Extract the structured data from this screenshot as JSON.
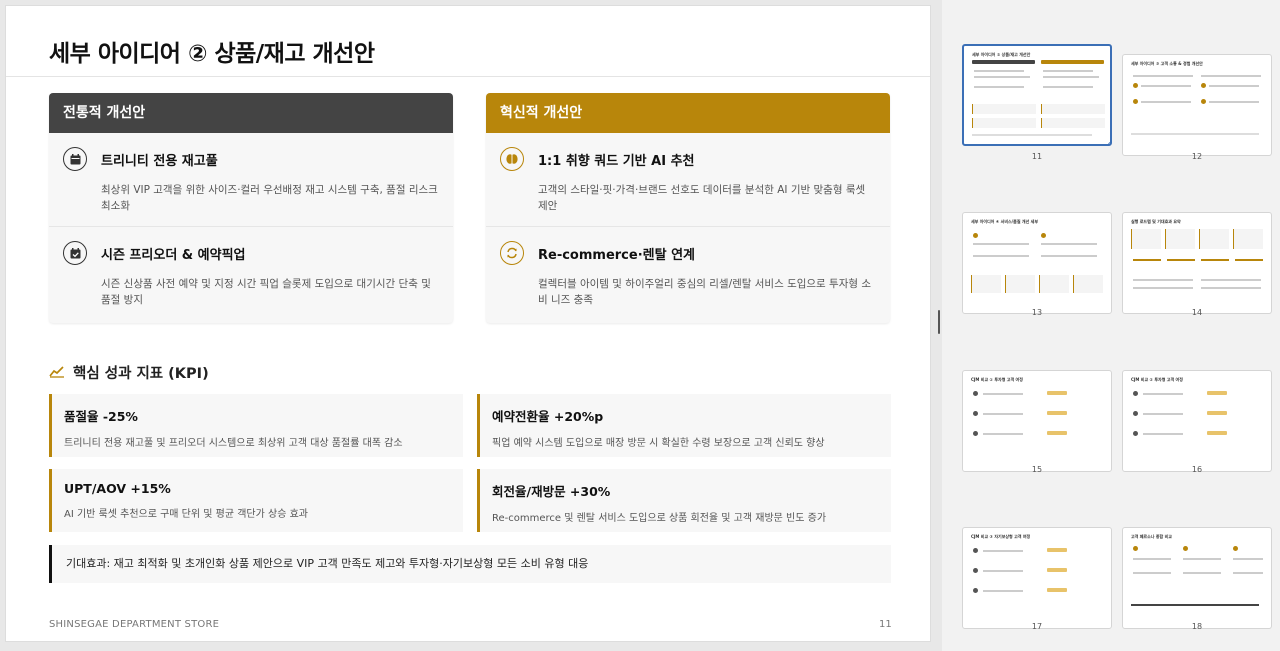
{
  "slide": {
    "title": "세부 아이디어 ② 상품/재고 개선안",
    "traditional": {
      "header": "전통적 개선안",
      "items": [
        {
          "icon": "calendar-icon",
          "title": "트리니티 전용 재고풀",
          "desc": "최상위 VIP 고객을 위한 사이즈·컬러 우선배정 재고 시스템 구축, 품절 리스크 최소화"
        },
        {
          "icon": "calendar-check-icon",
          "title": "시즌 프리오더 & 예약픽업",
          "desc": "시즌 신상품 사전 예약 및 지정 시간 픽업 슬롯제 도입으로 대기시간 단축 및 품절 방지"
        }
      ]
    },
    "innovative": {
      "header": "혁신적 개선안",
      "items": [
        {
          "icon": "brain-icon",
          "title": "1:1 취향 쿼드 기반 AI 추천",
          "desc": "고객의 스타일·핏·가격·브랜드 선호도 데이터를 분석한 AI 기반 맞춤형 룩셋 제안"
        },
        {
          "icon": "recycle-icon",
          "title": "Re-commerce·렌탈 연계",
          "desc": "컬렉터블 아이템 및 하이주얼리 중심의 리셀/렌탈 서비스 도입으로 투자형 소비 니즈 충족"
        }
      ]
    },
    "kpi": {
      "heading": "핵심 성과 지표 (KPI)",
      "items": [
        {
          "title": "품절율 -25%",
          "desc": "트리니티 전용 재고풀 및 프리오더 시스템으로 최상위 고객 대상 품절률 대폭 감소"
        },
        {
          "title": "예약전환율 +20%p",
          "desc": "픽업 예약 시스템 도입으로 매장 방문 시 확실한 수령 보장으로 고객 신뢰도 향상"
        },
        {
          "title": "UPT/AOV +15%",
          "desc": "AI 기반 룩셋 추천으로 구매 단위 및 평균 객단가 상승 효과"
        },
        {
          "title": "회전율/재방문 +30%",
          "desc": "Re-commerce 및 렌탈 서비스 도입으로 상품 회전율 및 고객 재방문 빈도 증가"
        }
      ]
    },
    "effect": "기대효과: 재고 최적화 및 초개인화 상품 제안으로 VIP 고객 만족도 제고와 투자형·자기보상형 모든 소비 유형 대응",
    "footer_brand": "SHINSEGAE DEPARTMENT STORE",
    "page_number": "11"
  },
  "colors": {
    "accent": "#b8860b",
    "dark_header": "#444444",
    "selection": "#3b6fb6"
  },
  "thumbnails": [
    {
      "number": "11",
      "title": "세부 아이디어 ② 상품/재고 개선안",
      "active": true
    },
    {
      "number": "12",
      "title": "세부 아이디어 ③ 고객 소통 & 경험 개선안",
      "active": false
    },
    {
      "number": "13",
      "title": "세부 아이디어 ④ 서비스/품질 개선 세부",
      "active": false
    },
    {
      "number": "14",
      "title": "실행 로드맵 및 기대효과 요약",
      "active": false
    },
    {
      "number": "15",
      "title": "CJM 비교 ① 투자형 고객 여정",
      "active": false
    },
    {
      "number": "16",
      "title": "CJM 비교 ② 투자형 고객 여정",
      "active": false
    },
    {
      "number": "17",
      "title": "CJM 비교 ③ 자기보상형 고객 여정",
      "active": false
    },
    {
      "number": "18",
      "title": "고객 페르소나 종합 비교",
      "active": false
    }
  ]
}
